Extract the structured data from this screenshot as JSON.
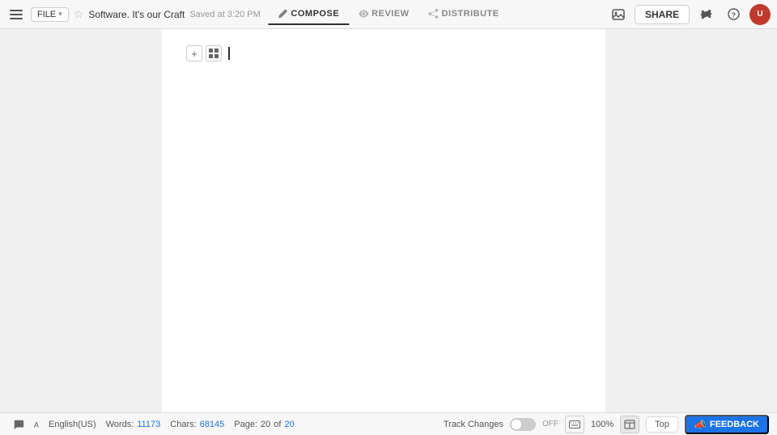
{
  "toolbar": {
    "file_label": "FILE",
    "doc_title": "Software. It's our Craft",
    "saved_status": "Saved at 3:20 PM",
    "tabs": [
      {
        "id": "compose",
        "label": "COMPOSE",
        "active": true,
        "icon": "pencil"
      },
      {
        "id": "review",
        "label": "REVIEW",
        "active": false,
        "icon": "eye"
      },
      {
        "id": "distribute",
        "label": "DISTRIBUTE",
        "active": false,
        "icon": "share-arrow"
      }
    ],
    "share_label": "SHARE"
  },
  "status_bar": {
    "words_label": "Words:",
    "words_count": "11173",
    "chars_label": "Chars:",
    "chars_count": "68145",
    "page_label": "Page:",
    "page_current": "20",
    "page_total": "20",
    "language": "English(US)",
    "track_changes_label": "Track Changes",
    "track_changes_state": "OFF",
    "zoom_level": "100%",
    "feedback_label": "FEEDBACK",
    "top_label": "Top"
  },
  "document": {
    "add_btn_label": "+",
    "grid_btn_label": "⊞"
  }
}
